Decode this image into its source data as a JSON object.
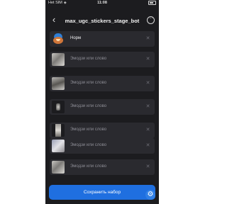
{
  "status_bar": {
    "carrier": "Het SIM",
    "time": "11:08"
  },
  "header": {
    "title": "max_ugc_stickers_stage_bot",
    "back_icon": "chevron-left-icon",
    "more_icon": "more-horizontal-icon"
  },
  "stickers": [
    {
      "label": "Норм",
      "filled": true,
      "thumb": "sticker"
    },
    {
      "label": "Эмодзи или слово",
      "filled": false,
      "thumb": "photo"
    },
    {
      "label": "Эмодзи или слово",
      "filled": false,
      "thumb": "photo2"
    },
    {
      "label": "Эмодзи или слово",
      "filled": false,
      "thumb": "dark"
    },
    {
      "label": "Эмодзи или слово",
      "filled": false,
      "thumb": "portrait"
    },
    {
      "label": "Эмодзи или слово",
      "filled": false,
      "thumb": "photo3"
    },
    {
      "label": "Эмодзи или слово",
      "filled": false,
      "thumb": "photo"
    }
  ],
  "save_button": {
    "label": "Сохранить набор"
  },
  "colors": {
    "background": "#1c1c1f",
    "row": "#2a2a2f",
    "accent": "#1f6fe0"
  }
}
